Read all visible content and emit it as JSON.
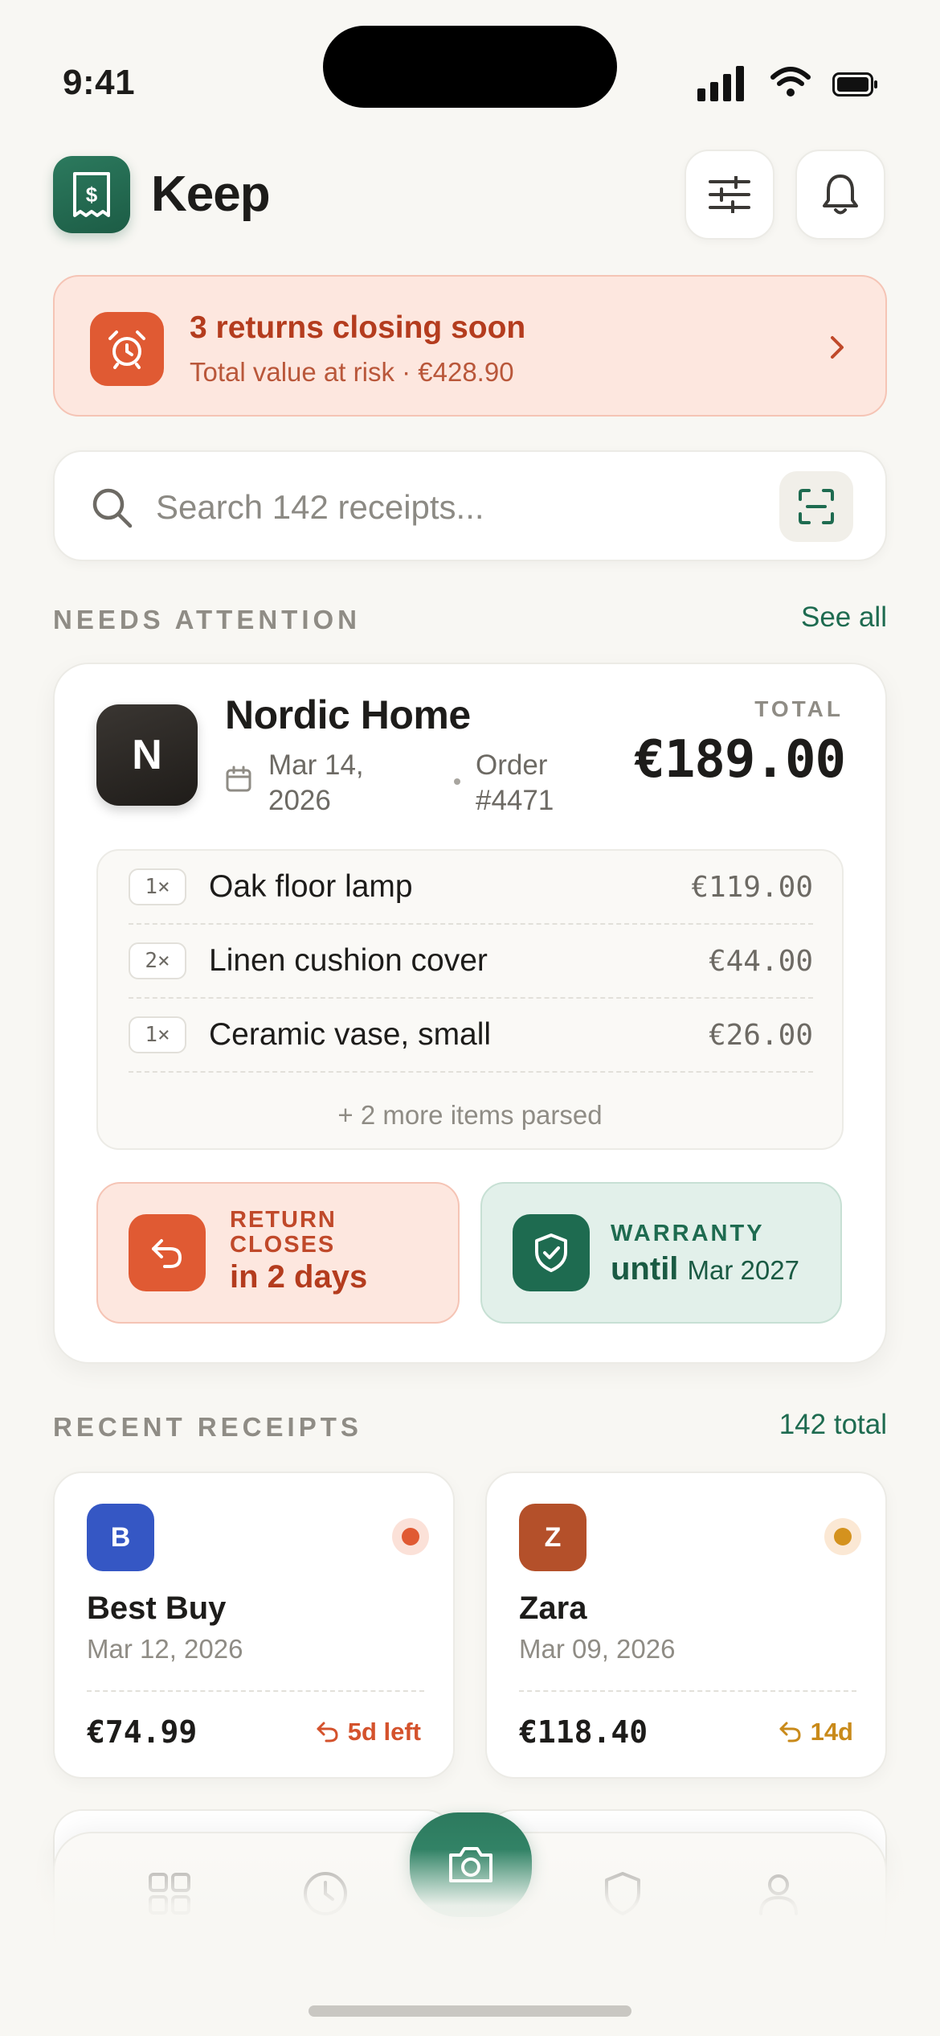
{
  "status_bar": {
    "time": "9:41"
  },
  "header": {
    "app_name": "Keep",
    "logo_icon": "receipt-icon",
    "filter_icon": "sliders-icon",
    "bell_icon": "bell-icon"
  },
  "alert": {
    "title": "3 returns closing soon",
    "subtitle": "Total value at risk · €428.90",
    "icon": "alarm-clock-icon",
    "accent": "#e05a33"
  },
  "search": {
    "placeholder": "Search 142 receipts...",
    "value": ""
  },
  "needs_attention": {
    "label": "NEEDS ATTENTION",
    "see_all": "See all",
    "receipt": {
      "merchant_initial": "N",
      "merchant": "Nordic Home",
      "date": "Mar 14, 2026",
      "order": "Order #4471",
      "total_label": "TOTAL",
      "total": "€189.00",
      "items": [
        {
          "qty": "1×",
          "name": "Oak floor lamp",
          "price": "€119.00"
        },
        {
          "qty": "2×",
          "name": "Linen cushion cover",
          "price": "€44.00"
        },
        {
          "qty": "1×",
          "name": "Ceramic vase, small",
          "price": "€26.00"
        }
      ],
      "more_items": "+ 2 more items parsed",
      "return": {
        "label": "RETURN CLOSES",
        "value": "in 2 days"
      },
      "warranty": {
        "label": "WARRANTY",
        "value_strong": "until",
        "value_date": "Mar 2027"
      }
    }
  },
  "recent": {
    "label": "RECENT RECEIPTS",
    "count": "142 total",
    "cards": [
      {
        "initial": "B",
        "merchant": "Best Buy",
        "date": "Mar 12, 2026",
        "amount": "€74.99",
        "return_left": "5d left",
        "logo_color": "#3557c4",
        "status_color": "#e05a33"
      },
      {
        "initial": "Z",
        "merchant": "Zara",
        "date": "Mar 09, 2026",
        "amount": "€118.40",
        "return_left": "14d",
        "logo_color": "#b4502a",
        "status_color": "#d4921e"
      }
    ]
  },
  "tabbar": {
    "tabs": [
      "grid-icon",
      "clock-icon",
      "camera-icon",
      "shield-icon",
      "user-icon"
    ],
    "active": "camera-icon"
  }
}
